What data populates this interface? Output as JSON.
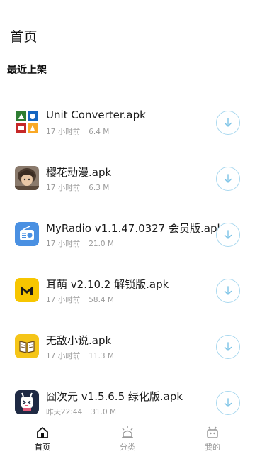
{
  "header": {
    "title": "首页"
  },
  "section": {
    "title": "最近上架"
  },
  "apps": [
    {
      "name": "Unit Converter.apk",
      "time": "17 小时前",
      "size": "6.4 M",
      "icon": "unit-converter-icon"
    },
    {
      "name": "樱花动漫.apk",
      "time": "17 小时前",
      "size": "6.3 M",
      "icon": "anime-avatar-icon"
    },
    {
      "name": "MyRadio v1.1.47.0327 会员版.apk",
      "time": "17 小时前",
      "size": "21.0 M",
      "icon": "radio-icon"
    },
    {
      "name": "耳萌 v2.10.2 解锁版.apk",
      "time": "17 小时前",
      "size": "58.4 M",
      "icon": "ermeng-logo-icon"
    },
    {
      "name": "无敌小说.apk",
      "time": "17 小时前",
      "size": "11.3 M",
      "icon": "book-icon"
    },
    {
      "name": "囧次元 v1.5.6.5 绿化版.apk",
      "time": "昨天22:44",
      "size": "31.0 M",
      "icon": "jiong-mascot-icon"
    }
  ],
  "tabbar": {
    "items": [
      {
        "label": "首页",
        "icon": "home-icon",
        "active": true
      },
      {
        "label": "分类",
        "icon": "category-icon",
        "active": false
      },
      {
        "label": "我的",
        "icon": "profile-robot-icon",
        "active": false
      }
    ]
  },
  "colors": {
    "download_ring": "#a9d8ef",
    "download_arrow": "#7cc3e6",
    "meta_text": "#9a9a9a",
    "tab_inactive": "#999999"
  }
}
